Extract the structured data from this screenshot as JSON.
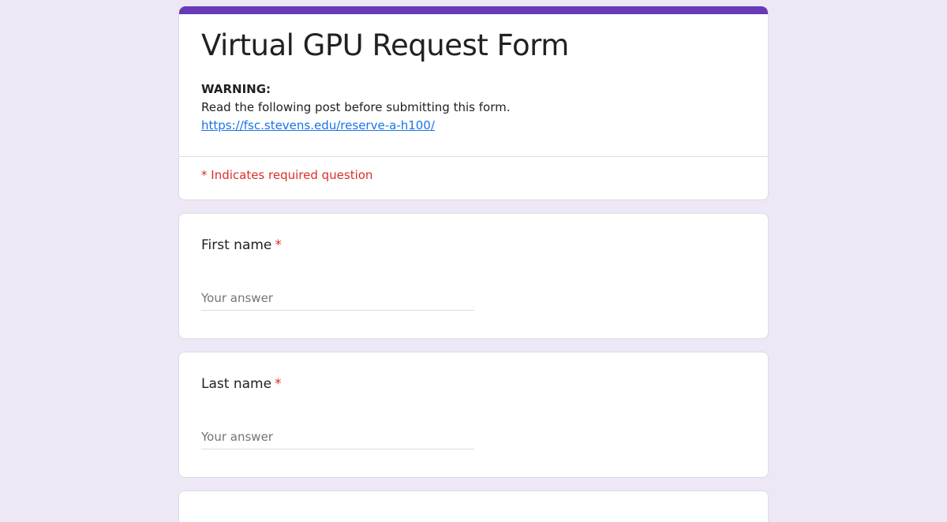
{
  "form": {
    "title": "Virtual GPU Request Form",
    "warning_label": "WARNING:",
    "description": "Read the following post before submitting this form.",
    "link_text": "https://fsc.stevens.edu/reserve-a-h100/",
    "required_note": "* Indicates required question",
    "accent_color": "#673ab7",
    "background_color": "#ede7f6"
  },
  "questions": [
    {
      "label": "First name",
      "required_mark": "*",
      "placeholder": "Your answer"
    },
    {
      "label": "Last name",
      "required_mark": "*",
      "placeholder": "Your answer"
    }
  ]
}
